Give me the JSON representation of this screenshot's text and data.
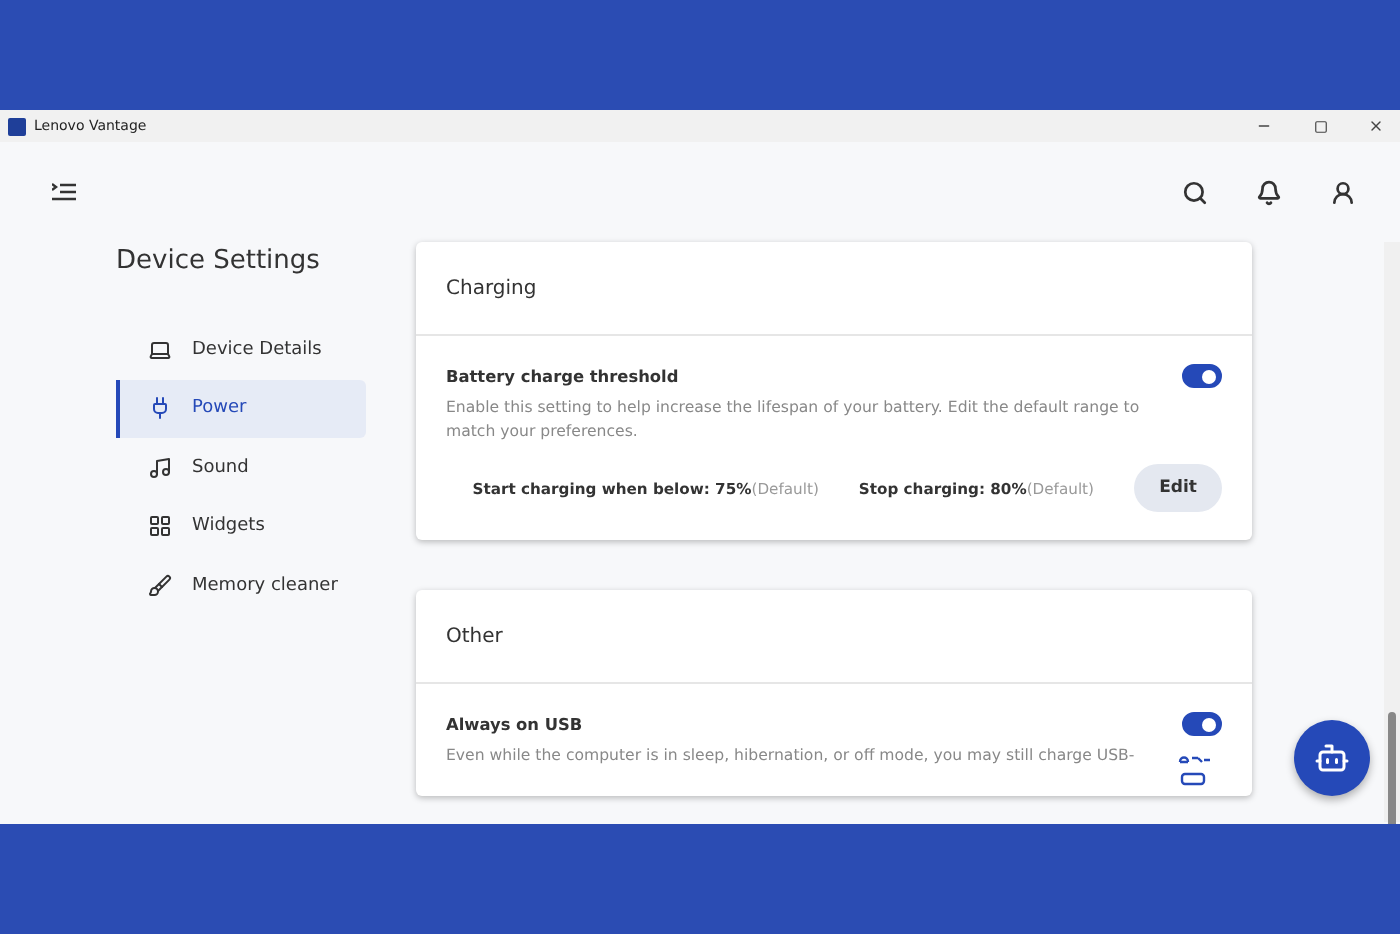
{
  "window": {
    "title": "Lenovo Vantage"
  },
  "sidebar": {
    "title": "Device Settings",
    "items": [
      {
        "label": "Device Details",
        "selected": false
      },
      {
        "label": "Power",
        "selected": true
      },
      {
        "label": "Sound",
        "selected": false
      },
      {
        "label": "Widgets",
        "selected": false
      },
      {
        "label": "Memory cleaner",
        "selected": false
      }
    ]
  },
  "sections": [
    {
      "title": "Charging",
      "settings": [
        {
          "kind": "threshold",
          "title": "Battery charge threshold",
          "on": true,
          "description": "Enable this setting to help increase the lifespan of your battery. Edit the default range to match your preferences.",
          "start_label": "Start charging when below: 75%",
          "start_note": "(Default)",
          "stop_label": "Stop charging: 80%",
          "stop_note": "(Default)",
          "button": "Edit"
        }
      ]
    },
    {
      "title": "Other",
      "settings": [
        {
          "kind": "usb",
          "title": "Always on USB",
          "on": true,
          "description": "Even while the computer is in sleep, hibernation, or off mode, you may still charge USB-"
        }
      ]
    }
  ]
}
